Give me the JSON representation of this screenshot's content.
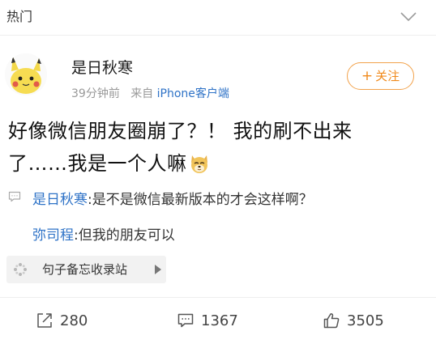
{
  "section": {
    "title": "热门"
  },
  "post": {
    "author": "是日秋寒",
    "time": "39分钟前",
    "source_prefix": "来自",
    "client": "iPhone客户端",
    "follow_label": "关注",
    "text_line1": "好像微信朋友圈崩了？！ 我的刷不出来",
    "text_line2": "了……我是一个人嘛",
    "emoji": "doge-emoji"
  },
  "comments": [
    {
      "user": "是日秋寒",
      "text": ":是不是微信最新版本的才会这样啊？"
    },
    {
      "user": "弥司程",
      "text": ":但我的朋友可以"
    }
  ],
  "source_chip": {
    "label": "句子备忘收录站"
  },
  "actions": {
    "repost": "280",
    "comment": "1367",
    "like": "3505"
  },
  "colors": {
    "link": "#2f73c7",
    "follow": "#f08a1c",
    "meta": "#999999"
  },
  "icons": [
    "chevron-down-icon",
    "comment-icon",
    "source-icon",
    "repost-icon",
    "like-icon"
  ]
}
